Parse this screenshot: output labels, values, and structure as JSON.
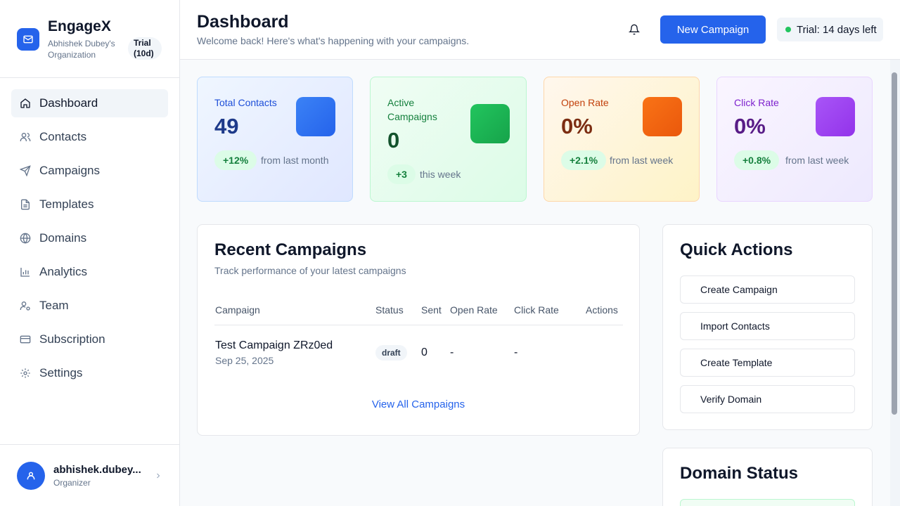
{
  "brand": {
    "name": "EngageX",
    "org": "Abhishek Dubey's Organization",
    "trial_pill": "Trial (10d)",
    "logo_icon": "mail-icon"
  },
  "sidebar": {
    "items": [
      {
        "label": "Dashboard",
        "icon": "home-icon",
        "active": true
      },
      {
        "label": "Contacts",
        "icon": "users-icon",
        "active": false
      },
      {
        "label": "Campaigns",
        "icon": "send-icon",
        "active": false
      },
      {
        "label": "Templates",
        "icon": "file-text-icon",
        "active": false
      },
      {
        "label": "Domains",
        "icon": "globe-icon",
        "active": false
      },
      {
        "label": "Analytics",
        "icon": "bar-chart-icon",
        "active": false
      },
      {
        "label": "Team",
        "icon": "user-cog-icon",
        "active": false
      },
      {
        "label": "Subscription",
        "icon": "credit-card-icon",
        "active": false
      },
      {
        "label": "Settings",
        "icon": "gear-icon",
        "active": false
      }
    ]
  },
  "user": {
    "name": "abhishek.dubey...",
    "role": "Organizer"
  },
  "header": {
    "title": "Dashboard",
    "subtitle": "Welcome back! Here's what's happening with your campaigns.",
    "new_campaign_label": "New Campaign",
    "trial_label": "Trial: 14 days left"
  },
  "stats": [
    {
      "label": "Total Contacts",
      "value": "49",
      "delta": "+12%",
      "sub": "from last month",
      "color": "#2563eb"
    },
    {
      "label": "Active Campaigns",
      "value": "0",
      "delta": "+3",
      "sub": "this week",
      "color": "#16a34a"
    },
    {
      "label": "Open Rate",
      "value": "0%",
      "delta": "+2.1%",
      "sub": "from last week",
      "color": "#ea580c"
    },
    {
      "label": "Click Rate",
      "value": "0%",
      "delta": "+0.8%",
      "sub": "from last week",
      "color": "#9333ea"
    }
  ],
  "recent": {
    "title": "Recent Campaigns",
    "subtitle": "Track performance of your latest campaigns",
    "columns": [
      "Campaign",
      "Status",
      "Sent",
      "Open Rate",
      "Click Rate",
      "Actions"
    ],
    "rows": [
      {
        "name": "Test Campaign ZRz0ed",
        "date": "Sep 25, 2025",
        "status": "draft",
        "sent": "0",
        "open_rate": "-",
        "click_rate": "-"
      }
    ],
    "view_all": "View All Campaigns"
  },
  "quick_actions": {
    "title": "Quick Actions",
    "items": [
      "Create Campaign",
      "Import Contacts",
      "Create Template",
      "Verify Domain"
    ]
  },
  "domain_status": {
    "title": "Domain Status"
  }
}
